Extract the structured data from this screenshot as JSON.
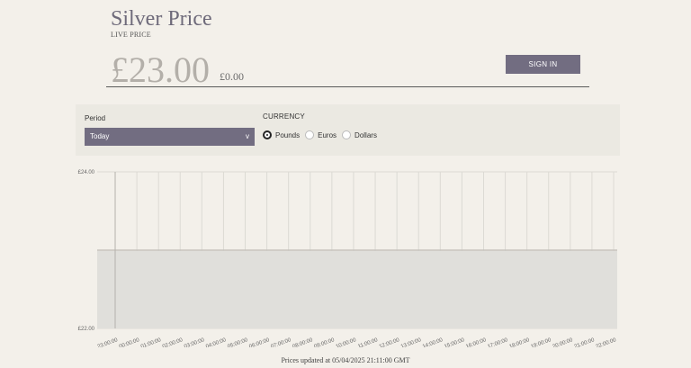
{
  "header": {
    "title": "Silver Price",
    "subtitle": "LIVE PRICE",
    "price": "£23.00",
    "change": "£0.00",
    "sign_in_label": "SIGN IN"
  },
  "controls": {
    "period_label": "Period",
    "period_value": "Today",
    "period_caret": "v",
    "currency_label": "CURRENCY",
    "currencies": [
      {
        "label": "Pounds",
        "selected": true
      },
      {
        "label": "Euros",
        "selected": false
      },
      {
        "label": "Dollars",
        "selected": false
      }
    ]
  },
  "chart_data": {
    "type": "area",
    "y_tick_labels": [
      "£24.00",
      "£22.00"
    ],
    "y_ticks": [
      24,
      22
    ],
    "ylim": [
      22,
      24
    ],
    "x": [
      "23:00:00",
      "00:00:00",
      "01:00:00",
      "02:00:00",
      "03:00:00",
      "04:00:00",
      "05:00:00",
      "06:00:00",
      "07:00:00",
      "08:00:00",
      "09:00:00",
      "10:00:00",
      "11:00:00",
      "12:00:00",
      "13:00:00",
      "14:00:00",
      "15:00:00",
      "16:00:00",
      "17:00:00",
      "18:00:00",
      "19:00:00",
      "20:00:00",
      "21:00:00",
      "22:00:00"
    ],
    "values": [
      23.0,
      23.0,
      23.0,
      23.0,
      23.0,
      23.0,
      23.0,
      23.0,
      23.0,
      23.0,
      23.0,
      23.0,
      23.0,
      23.0,
      23.0,
      23.0,
      23.0,
      23.0,
      23.0,
      23.0,
      23.0,
      23.0,
      23.0,
      23.0
    ],
    "grid": true,
    "colors": {
      "fill": "#e0dfdb",
      "line": "#c9c6c0",
      "grid": "#dcdad4",
      "text": "#666666"
    }
  },
  "footer": {
    "updated_text": "Prices updated at 05/04/2025 21:11:00 GMT"
  }
}
